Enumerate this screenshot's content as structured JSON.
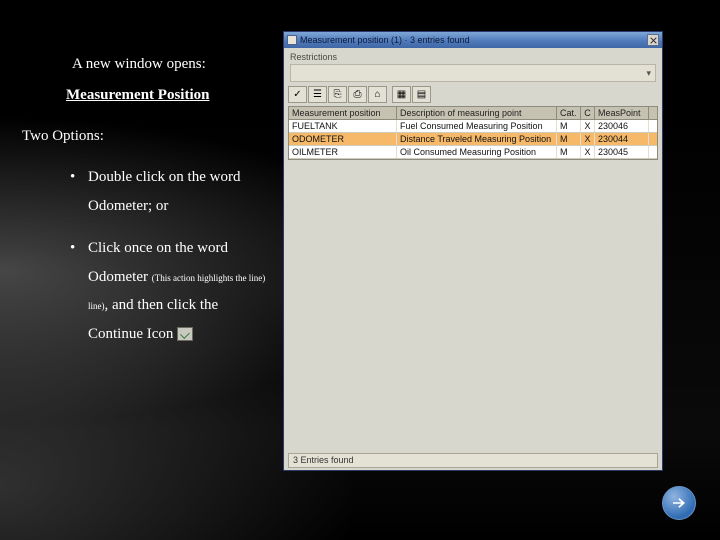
{
  "left_panel": {
    "intro": "A new window opens:",
    "title": "Measurement Position",
    "two_options": "Two Options:",
    "bullets": [
      {
        "line1": "Double click on the word",
        "line2": "Odometer; or"
      },
      {
        "line1": "Click once on the word",
        "line2a": "Odometer ",
        "paren": "(This action highlights the line)",
        "line2b": ", and then click the",
        "line3": "Continue Icon "
      }
    ]
  },
  "window": {
    "title_full": "Measurement position (1) · 3 entries found",
    "close": "×",
    "restrict_label": "Restrictions",
    "toolbar": {
      "check": "✓",
      "i1": "☰",
      "i2": "⎘",
      "i3": "⎙",
      "i4": "⌂",
      "i5": "▦",
      "i6": "▤"
    },
    "columns": {
      "mp": "Measurement position",
      "desc": "Description of measuring point",
      "cat": "Cat.",
      "cc": "C",
      "meas": "MeasPoint"
    },
    "rows": [
      {
        "mp": "FUELTANK",
        "desc": "Fuel Consumed Measuring Position",
        "cat": "M",
        "cc": "X",
        "meas": "230046",
        "sel": false
      },
      {
        "mp": "ODOMETER",
        "desc": "Distance Traveled Measuring Position",
        "cat": "M",
        "cc": "X",
        "meas": "230044",
        "sel": true
      },
      {
        "mp": "OILMETER",
        "desc": "Oil Consumed Measuring Position",
        "cat": "M",
        "cc": "X",
        "meas": "230045",
        "sel": false
      }
    ],
    "status": "3 Entries found"
  }
}
